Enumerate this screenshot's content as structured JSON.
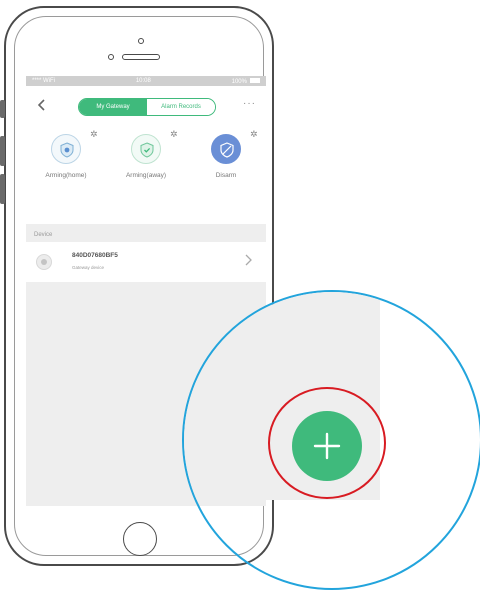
{
  "app": {
    "statusbar": {
      "left": "**** WiFi",
      "center": "10:08",
      "right": "100%"
    },
    "topbar": {
      "back_icon": "chevron-left-icon",
      "tabs": [
        {
          "label": "My Gateway",
          "active": true
        },
        {
          "label": "Alarm Records",
          "active": false
        }
      ],
      "more_label": "···"
    },
    "modes": [
      {
        "label": "Arming(home)",
        "icon": "shield-home-icon"
      },
      {
        "label": "Arming(away)",
        "icon": "shield-away-icon"
      },
      {
        "label": "Disarm",
        "icon": "shield-disarm-icon"
      }
    ],
    "section": {
      "label": "Device"
    },
    "device": {
      "name": "840D07680BF5",
      "subtitle": "Gateway device"
    },
    "add_button": {
      "icon": "plus-icon"
    }
  },
  "colors": {
    "accent": "#3fba7c",
    "zoom_ring": "#22a4dc",
    "highlight_ring": "#d81b22",
    "disarm": "#6a8fd6"
  }
}
